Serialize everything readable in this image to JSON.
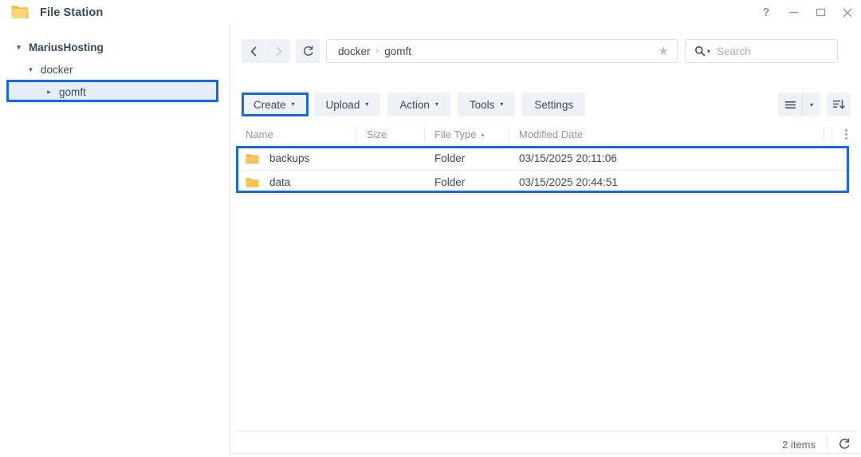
{
  "window": {
    "title": "File Station",
    "app_icon": "folder-icon",
    "controls": [
      {
        "name": "help-button",
        "glyph": "?"
      },
      {
        "name": "minimize-button",
        "glyph": "minimize-icon"
      },
      {
        "name": "maximize-button",
        "glyph": "maximize-icon"
      },
      {
        "name": "close-button",
        "glyph": "close-icon"
      }
    ]
  },
  "sidebar": {
    "items": [
      {
        "label": "MariusHosting",
        "level": 0,
        "caret": "▾",
        "selected": false
      },
      {
        "label": "docker",
        "level": 1,
        "caret": "▾",
        "selected": false
      },
      {
        "label": "gomft",
        "level": 2,
        "caret": "▸",
        "selected": true
      }
    ]
  },
  "nav": {
    "back_icon": "chevron-left-icon",
    "forward_icon": "chevron-right-icon",
    "refresh_icon": "refresh-icon",
    "breadcrumb": [
      "docker",
      "gomft"
    ],
    "breadcrumb_separator": "›",
    "favorite_icon": "star-icon",
    "favorite_glyph": "★"
  },
  "search": {
    "icon": "search-icon",
    "caret": "▾",
    "placeholder": "Search",
    "value": ""
  },
  "toolbar": {
    "buttons": [
      {
        "label": "Create",
        "caret": "▾",
        "highlighted": true
      },
      {
        "label": "Upload",
        "caret": "▾",
        "highlighted": false
      },
      {
        "label": "Action",
        "caret": "▾",
        "highlighted": false
      },
      {
        "label": "Tools",
        "caret": "▾",
        "highlighted": false
      },
      {
        "label": "Settings",
        "caret": "",
        "highlighted": false
      }
    ],
    "view_icon": "list-view-icon",
    "view_caret": "▾",
    "sort_icon": "sort-descending-icon"
  },
  "filelist": {
    "columns": [
      {
        "label": "Name",
        "sorted": false
      },
      {
        "label": "Size",
        "sorted": false
      },
      {
        "label": "File Type",
        "sorted": true,
        "sort_arrow": "▴"
      },
      {
        "label": "Modified Date",
        "sorted": false
      }
    ],
    "options_icon": "kebab-menu-icon",
    "rows": [
      {
        "icon": "folder-icon",
        "name": "backups",
        "size": "",
        "type": "Folder",
        "modified": "03/15/2025 20:11:06"
      },
      {
        "icon": "folder-icon",
        "name": "data",
        "size": "",
        "type": "Folder",
        "modified": "03/15/2025 20:44:51"
      }
    ]
  },
  "status": {
    "count": "2 items",
    "refresh_icon": "refresh-icon"
  },
  "colors": {
    "annotation": "#1569e8",
    "selection_fill": "#e4edf9",
    "folder": "#fcc köz"
  }
}
